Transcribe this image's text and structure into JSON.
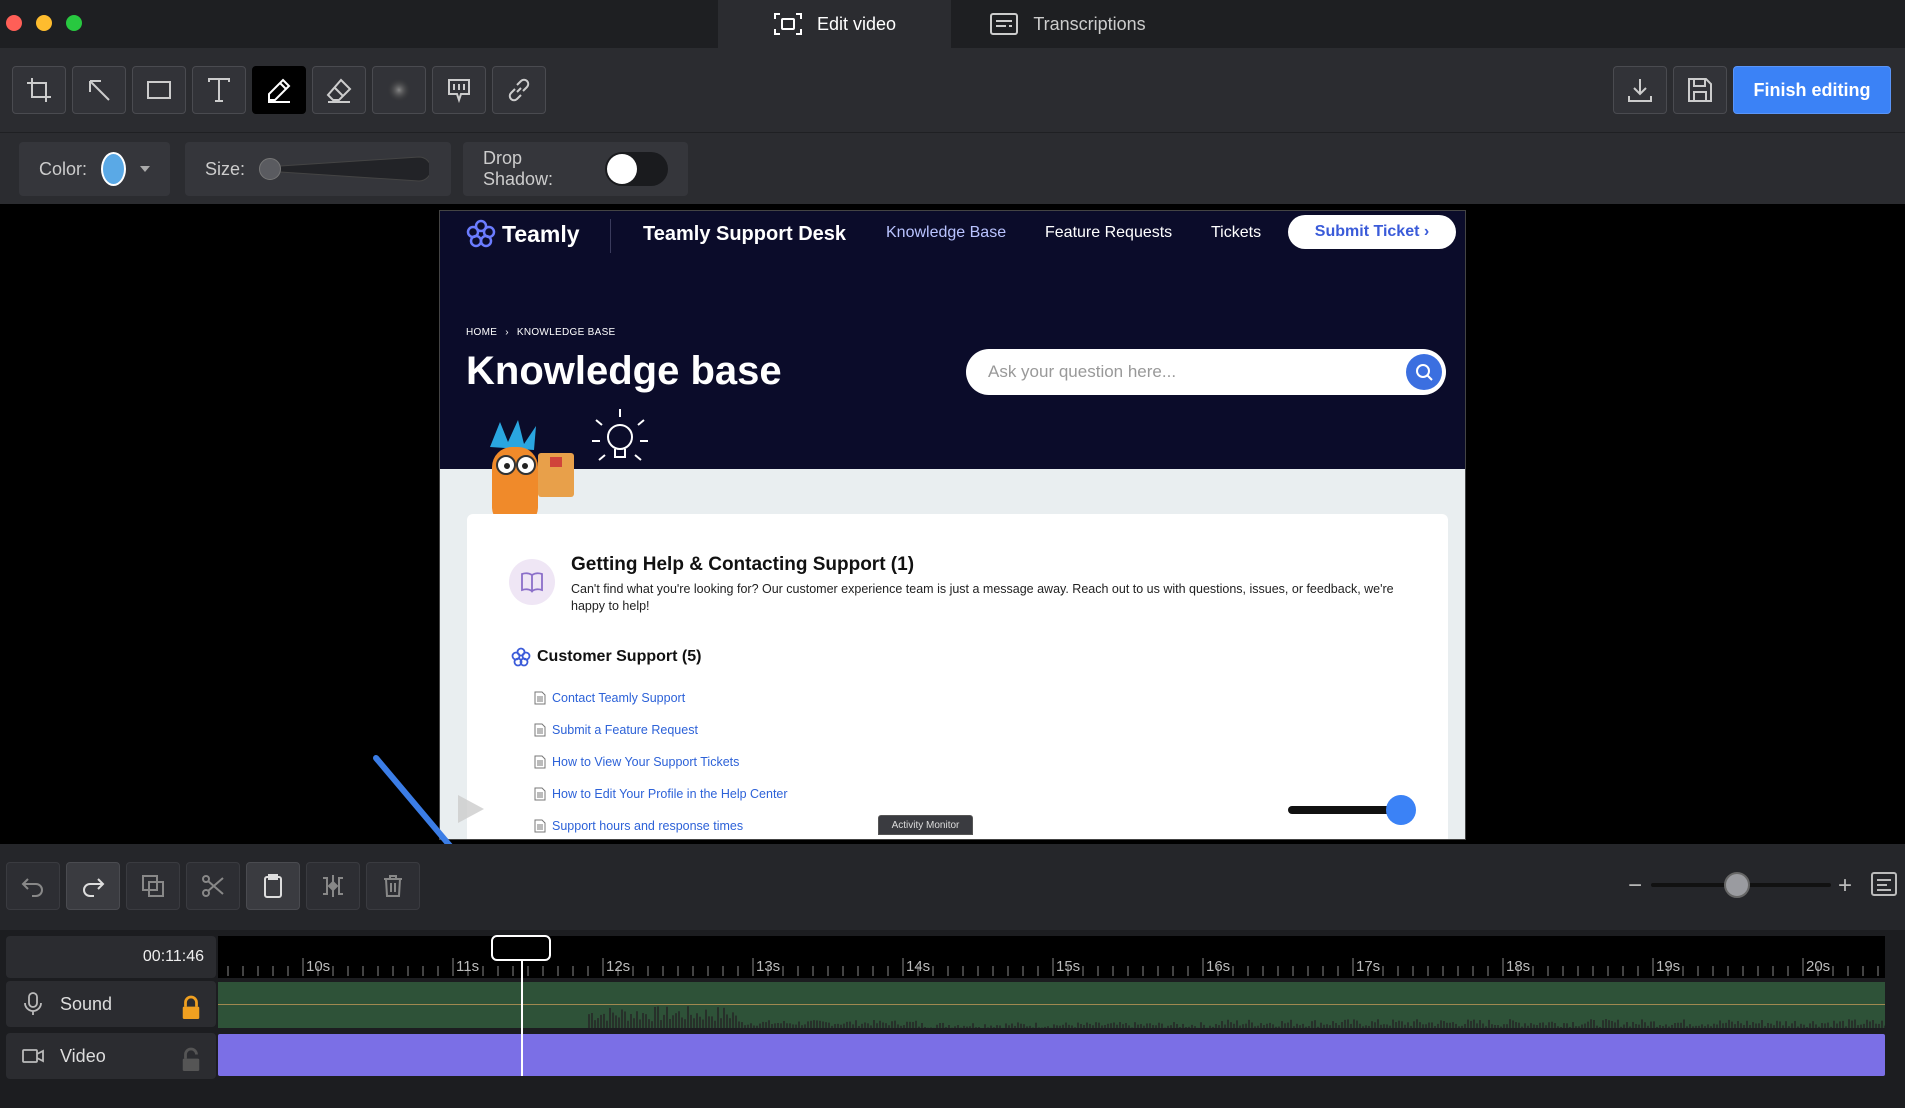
{
  "tabs": [
    {
      "label": "Edit video",
      "icon": "screen-record-icon",
      "active": true
    },
    {
      "label": "Transcriptions",
      "icon": "transcript-icon",
      "active": false
    }
  ],
  "toolbar": {
    "tools": [
      "crop-icon",
      "arrow-icon",
      "rectangle-icon",
      "text-icon",
      "pen-icon",
      "eraser-icon",
      "blur-icon",
      "highlight-icon",
      "link-icon"
    ],
    "active_tool": "pen-icon",
    "finish_label": "Finish editing"
  },
  "options": {
    "color_label": "Color:",
    "color_value": "#5aa9e6",
    "size_label": "Size:",
    "size_value": 0,
    "drop_shadow_label": "Drop Shadow:",
    "drop_shadow_on": false
  },
  "preview": {
    "logo": "Teamly",
    "site_title": "Teamly Support Desk",
    "nav": [
      "Knowledge Base",
      "Feature Requests",
      "Tickets"
    ],
    "submit_label": "Submit Ticket ›",
    "breadcrumb": [
      "HOME",
      "›",
      "KNOWLEDGE BASE"
    ],
    "page_title": "Knowledge base",
    "search_placeholder": "Ask your question here...",
    "category": {
      "title": "Getting Help & Contacting Support (1)",
      "description": "Can't find what you're looking for? Our customer experience team is just a message away. Reach out to us with questions, issues, or feedback, we're happy to help!"
    },
    "subcategory": "Customer Support (5)",
    "articles": [
      "Contact Teamly Support",
      "Submit a Feature Request",
      "How to View Your Support Tickets",
      "How to Edit Your Profile in the Help Center",
      "Support hours and response times"
    ],
    "tooltip": "Activity Monitor"
  },
  "edit_bar": {
    "buttons": [
      "undo-icon",
      "redo-icon",
      "duplicate-icon",
      "cut-icon",
      "paste-icon",
      "split-icon",
      "delete-icon"
    ],
    "zoom_minus": "−",
    "zoom_plus": "+"
  },
  "timeline": {
    "current_time": "00:11:46",
    "ticks": [
      "10s",
      "11s",
      "12s",
      "13s",
      "14s",
      "15s",
      "16s",
      "17s",
      "18s",
      "19s",
      "20s"
    ],
    "tracks": [
      {
        "label": "Sound",
        "locked": true
      },
      {
        "label": "Video",
        "locked": false
      }
    ]
  },
  "colors": {
    "accent": "#3b82f6",
    "video_track": "#7b6fe6",
    "sound_track": "#2e5238",
    "preview_bg": "#0b0c2a"
  }
}
